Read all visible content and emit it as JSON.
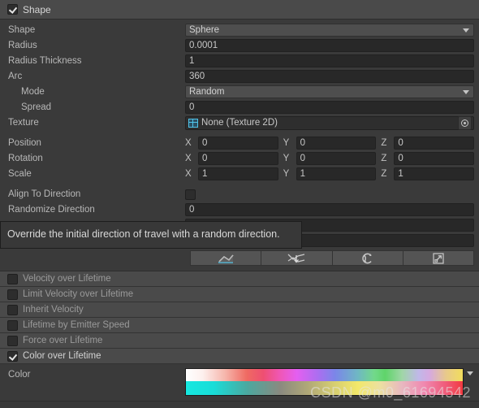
{
  "module": {
    "title": "Shape",
    "enabled": true
  },
  "shape_fields": [
    {
      "label": "Shape",
      "type": "popup",
      "value": "Sphere",
      "indent": false
    },
    {
      "label": "Radius",
      "type": "text",
      "value": "0.0001",
      "indent": false
    },
    {
      "label": "Radius Thickness",
      "type": "text",
      "value": "1",
      "indent": false
    },
    {
      "label": "Arc",
      "type": "text",
      "value": "360",
      "indent": false
    },
    {
      "label": "Mode",
      "type": "popup",
      "value": "Random",
      "indent": true
    },
    {
      "label": "Spread",
      "type": "text",
      "value": "0",
      "indent": true
    },
    {
      "label": "Texture",
      "type": "object",
      "value": "None (Texture 2D)",
      "indent": false,
      "icon": "texture-2d-icon",
      "picker": "object-picker-icon"
    }
  ],
  "transform_rows": [
    {
      "label": "Position",
      "axes": [
        {
          "name": "X",
          "value": "0"
        },
        {
          "name": "Y",
          "value": "0"
        },
        {
          "name": "Z",
          "value": "0"
        }
      ]
    },
    {
      "label": "Rotation",
      "axes": [
        {
          "name": "X",
          "value": "0"
        },
        {
          "name": "Y",
          "value": "0"
        },
        {
          "name": "Z",
          "value": "0"
        }
      ]
    },
    {
      "label": "Scale",
      "axes": [
        {
          "name": "X",
          "value": "1"
        },
        {
          "name": "Y",
          "value": "1"
        },
        {
          "name": "Z",
          "value": "1"
        }
      ]
    }
  ],
  "direction_rows": [
    {
      "label": "Align To Direction",
      "type": "checkbox",
      "value": false
    },
    {
      "label": "Randomize Direction",
      "type": "text",
      "value": "0"
    },
    {
      "label": "",
      "type": "text",
      "value": ""
    },
    {
      "label": "",
      "type": "text",
      "value": ""
    }
  ],
  "toolbar": {
    "buttons": [
      {
        "name": "constant-curve-button",
        "icon": "curve-icon"
      },
      {
        "name": "random-between-curves-button",
        "icon": "random-range-icon"
      },
      {
        "name": "cycle-curve-button",
        "icon": "cycle-icon"
      },
      {
        "name": "open-curve-editor-button",
        "icon": "expand-icon"
      }
    ]
  },
  "tooltip": {
    "text": "Override the initial direction of travel with a random direction."
  },
  "modules": [
    {
      "label": "Velocity over Lifetime",
      "enabled": false
    },
    {
      "label": "Limit Velocity over Lifetime",
      "enabled": false
    },
    {
      "label": "Inherit Velocity",
      "enabled": false
    },
    {
      "label": "Lifetime by Emitter Speed",
      "enabled": false
    },
    {
      "label": "Force over Lifetime",
      "enabled": false
    },
    {
      "label": "Color over Lifetime",
      "enabled": true
    }
  ],
  "color_section": {
    "label": "Color",
    "gradient_top": "linear-gradient(to right, #ffffff 0%, #fdf0ee 6%, #f6b7ad 14%, #ef6a62 22%, #ee4f72 28%, #ef57b6 34%, #e45ff0 40%, #a96ff0 48%, #7a87e8 54%, #6fb7c4 62%, #72d98a 68%, #5fd46a 72%, #9fd6a6 78%, #c0b8e8 84%, #d6a9e0 88%, #e8c98a 94%, #f2dd5c 100%)",
    "gradient_bottom": "linear-gradient(to right, #15e8e0 0%, #19ddd8 10%, #4aa9a0 22%, #8a8a80 34%, #b0a878 44%, #d8d070 54%, #f2e86a 62%, #ece0a0 70%, #e8b8c0 78%, #f088b0 86%, #f05a78 94%, #f23a40 100%)",
    "dropdown": "gradient-dropdown-icon"
  },
  "watermark": "CSDN @m0_61694542"
}
